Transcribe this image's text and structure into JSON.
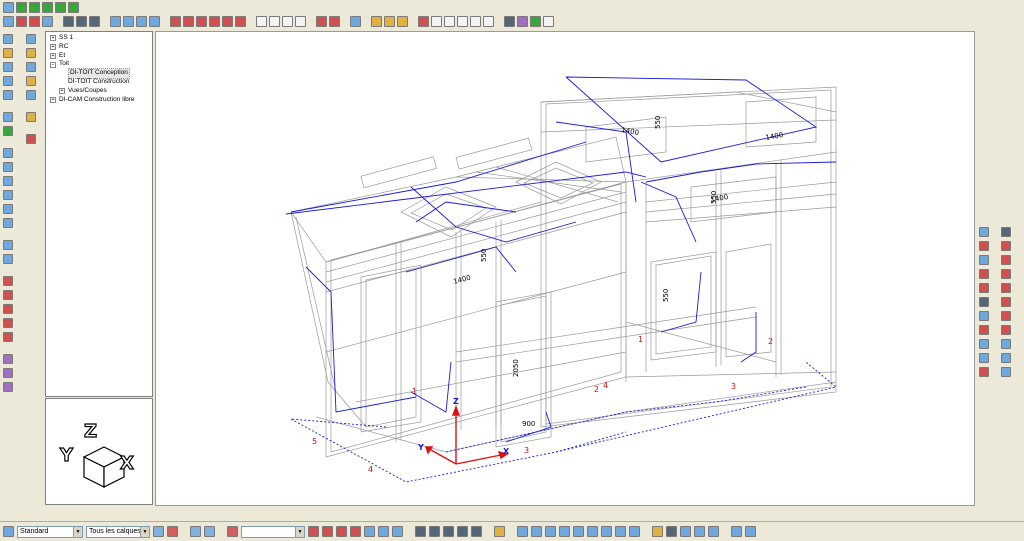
{
  "tree": {
    "items": [
      {
        "label": "SS 1",
        "level": 0,
        "toggle": "+"
      },
      {
        "label": "RC",
        "level": 0,
        "toggle": "+"
      },
      {
        "label": "Et",
        "level": 0,
        "toggle": "+"
      },
      {
        "label": "Toit",
        "level": 0,
        "toggle": "−"
      },
      {
        "label": "DI-TOIT Conception",
        "level": 1,
        "toggle": "",
        "selected": true
      },
      {
        "label": "DI-TOIT Construction",
        "level": 1,
        "toggle": ""
      },
      {
        "label": "Vues/Coupes",
        "level": 1,
        "toggle": "+"
      },
      {
        "label": "DI-CAM Construction libre",
        "level": 0,
        "toggle": "+"
      }
    ]
  },
  "statusbar": {
    "style_select": "Standard",
    "layers_select": "Tous les calques",
    "extra_select": ""
  },
  "drawing": {
    "dim_labels": [
      "1400",
      "1400",
      "1400",
      "1400",
      "2050",
      "900",
      "550",
      "550",
      "550",
      "550"
    ],
    "axis_labels": [
      "Z",
      "Y",
      "X"
    ],
    "marker_labels": [
      "1",
      "2",
      "3",
      "4",
      "5",
      "1",
      "2",
      "3",
      "4"
    ]
  },
  "cube": {
    "labels": [
      "Z",
      "Y",
      "X"
    ]
  },
  "colors": {
    "accent_blue": "#1a1adc",
    "axis_red": "#dd1111",
    "wire": "#9a9a9a",
    "panel_bg": "#ece9d8"
  }
}
